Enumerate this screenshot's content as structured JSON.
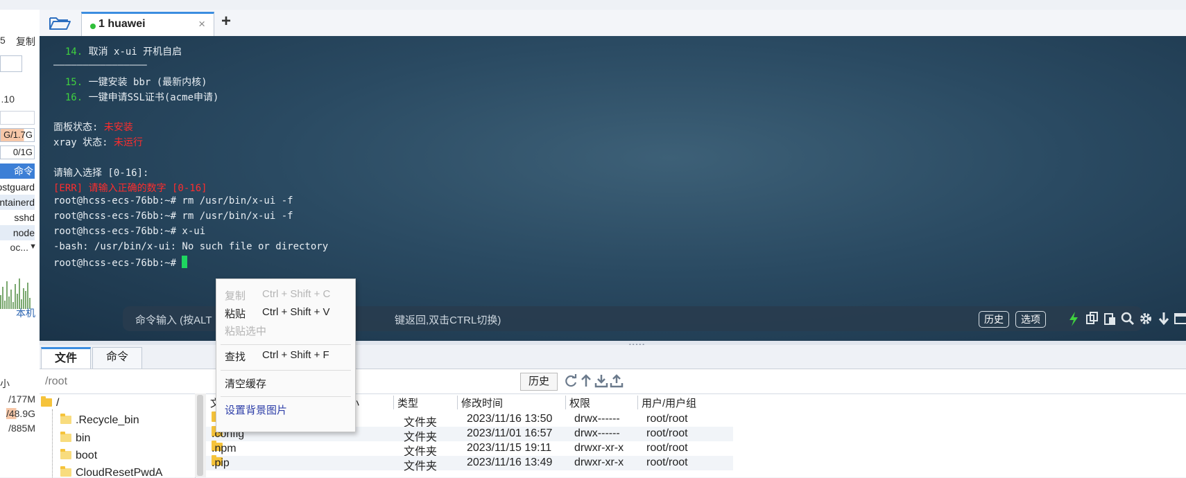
{
  "sidebar": {
    "copy_label": "复制",
    "ip_fragment": ".10",
    "mem_values": [
      "G/1.7G",
      "0/1G"
    ],
    "process_selected": "命令",
    "processes": [
      "postguard",
      "containerd",
      "sshd",
      "node"
    ],
    "dropdown_label": "oc...",
    "local_label": "本机",
    "size_header": "小",
    "sizes": [
      "/177M",
      "/48.9G",
      "/885M"
    ]
  },
  "tabs": [
    {
      "label": "1 huawei",
      "status": "connected",
      "active": true
    }
  ],
  "terminal": {
    "lines": [
      {
        "num": "14.",
        "text": " 取消 x-ui 开机自启"
      },
      {
        "text": "————————————————"
      },
      {
        "num": "15.",
        "text": " 一键安装 bbr (最新内核)"
      },
      {
        "num": "16.",
        "text": " 一键申请SSL证书(acme申请)"
      },
      {
        "label": "面板状态: ",
        "red": "未安装"
      },
      {
        "label": "xray 状态: ",
        "red": "未运行"
      },
      {
        "text": "请输入选择 [0-16]:"
      },
      {
        "red": "[ERR] 请输入正确的数字 [0-16]"
      },
      {
        "text": "root@hcss-ecs-76bb:~# rm /usr/bin/x-ui -f"
      },
      {
        "text": "root@hcss-ecs-76bb:~# rm /usr/bin/x-ui -f"
      },
      {
        "text": "root@hcss-ecs-76bb:~# x-ui"
      },
      {
        "text": "-bash: /usr/bin/x-ui: No such file or directory"
      },
      {
        "text": "root@hcss-ecs-76bb:~# "
      }
    ],
    "cmd_placeholder_left": "命令输入 (按ALT",
    "cmd_placeholder_right": "键返回,双击CTRL切换)",
    "history_btn": "历史",
    "options_btn": "选项"
  },
  "context_menu": {
    "items": [
      {
        "label": "复制",
        "shortcut": "Ctrl + Shift + C",
        "enabled": false
      },
      {
        "label": "粘贴",
        "shortcut": "Ctrl + Shift + V",
        "enabled": true
      },
      {
        "label": "粘贴选中",
        "shortcut": "",
        "enabled": false
      },
      {
        "label": "查找",
        "shortcut": "Ctrl + Shift + F",
        "enabled": true
      },
      {
        "label": "清空缓存",
        "shortcut": "",
        "enabled": true
      },
      {
        "label": "设置背景图片",
        "shortcut": "",
        "enabled": true
      }
    ]
  },
  "bottom": {
    "tabs": [
      "文件",
      "命令"
    ],
    "path": "/root",
    "history_btn": "历史",
    "tree": {
      "root": "/",
      "items": [
        ".Recycle_bin",
        "bin",
        "boot",
        "CloudResetPwdA"
      ]
    },
    "columns": [
      "文",
      "小",
      "类型",
      "修改时间",
      "权限",
      "用户/用户组"
    ],
    "files": [
      {
        "name": "",
        "type": "文件夹",
        "mtime": "2023/11/16 13:50",
        "perm": "drwx------",
        "owner": "root/root"
      },
      {
        "name": ".config",
        "type": "文件夹",
        "mtime": "2023/11/01 16:57",
        "perm": "drwx------",
        "owner": "root/root"
      },
      {
        "name": ".npm",
        "type": "文件夹",
        "mtime": "2023/11/15 19:11",
        "perm": "drwxr-xr-x",
        "owner": "root/root"
      },
      {
        "name": ".pip",
        "type": "文件夹",
        "mtime": "2023/11/16 13:49",
        "perm": "drwxr-xr-x",
        "owner": "root/root"
      }
    ]
  },
  "colors": {
    "accent": "#3b8de0",
    "terminal_green": "#3fd23f",
    "terminal_red": "#ff2d2d",
    "cursor": "#1ed760"
  }
}
